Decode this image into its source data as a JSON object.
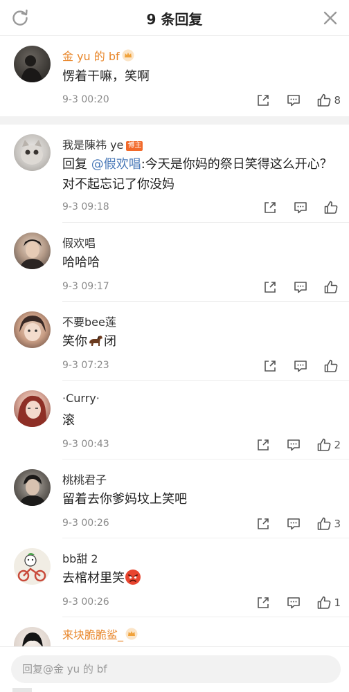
{
  "header": {
    "title": "9 条回复"
  },
  "main_comment": {
    "name": "金 yu 的 bf",
    "text": "愣着干嘛，笑啊",
    "time": "9-3 00:20",
    "likes": "8"
  },
  "replies": [
    {
      "name": "我是陳祎 ye",
      "badge": "博主",
      "prefix": "回复 ",
      "mention": "@假欢唱",
      "text": ":今天是你妈的祭日笑得这么开心？对不起忘记了你没妈",
      "time": "9-3 09:18",
      "likes": ""
    },
    {
      "name": "假欢唱",
      "text": "哈哈哈",
      "time": "9-3 09:17",
      "likes": ""
    },
    {
      "name": "不要bee莲",
      "text_a": "笑你",
      "text_b": "闭",
      "time": "9-3 07:23",
      "likes": ""
    },
    {
      "name": "·Curry·",
      "text": "滚",
      "time": "9-3 00:43",
      "likes": "2"
    },
    {
      "name": "桃桃君子",
      "text": "留着去你爹妈坟上笑吧",
      "time": "9-3 00:26",
      "likes": "3"
    },
    {
      "name": "bb甜 2",
      "text": "去棺材里笑",
      "time": "9-3 00:26",
      "likes": "1"
    },
    {
      "name": "来块脆脆鲨_"
    }
  ],
  "footer": {
    "placeholder": "回复@金 yu 的 bf"
  },
  "colors": {
    "accent_orange": "#e8862a",
    "mention_blue": "#4a79b8",
    "badge_orange": "#f26a2b",
    "meta_gray": "#8a8a8a"
  },
  "icons": [
    "refresh-icon",
    "close-icon",
    "share-icon",
    "comment-icon",
    "like-icon",
    "crown-badge-icon",
    "horse-emoji",
    "angry-face-emoji"
  ]
}
